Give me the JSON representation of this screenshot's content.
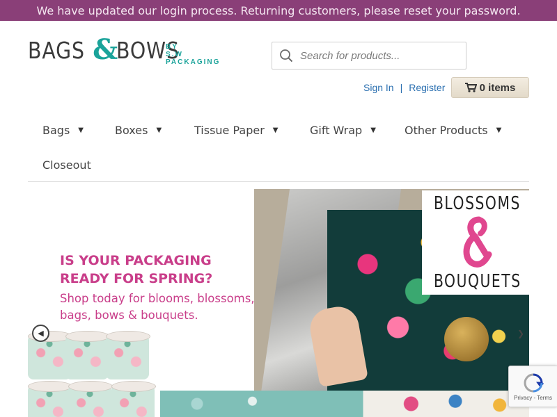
{
  "announcement": "We have updated our login process.  Returning customers, please reset your password.",
  "logo": {
    "word_left": "BAGS",
    "amp": "&",
    "word_right": "BOWS",
    "by": "BY",
    "company": "S.W PACKAGING"
  },
  "search": {
    "placeholder": "Search for products...",
    "icon": "search-icon"
  },
  "account": {
    "sign_in": "Sign In",
    "separator": "|",
    "register": "Register"
  },
  "cart": {
    "icon": "cart-icon",
    "label": "0 items"
  },
  "nav": {
    "items": [
      {
        "label": "Bags",
        "caret": "▼"
      },
      {
        "label": "Boxes",
        "caret": "▼"
      },
      {
        "label": "Tissue Paper",
        "caret": "▼"
      },
      {
        "label": "Gift Wrap",
        "caret": "▼"
      },
      {
        "label": "Other Products",
        "caret": "▼"
      },
      {
        "label": "Closeout"
      }
    ]
  },
  "hero": {
    "headline_line1": "IS YOUR PACKAGING",
    "headline_line2": "READY FOR SPRING?",
    "sub_line1": "Shop today for blooms, blossoms,",
    "sub_line2": "bags, bows & bouquets.",
    "badge_top": "BLOSSOMS",
    "badge_bottom": "BOUQUETS",
    "prev_icon": "chevron-left-icon",
    "next_icon": "chevron-right-icon"
  },
  "recaptcha": {
    "footer": "Privacy - Terms"
  },
  "colors": {
    "announcement_bg": "#8a3f78",
    "brand_teal": "#1aa39a",
    "hero_pink": "#c93e8a",
    "link_blue": "#2a6fb0"
  }
}
